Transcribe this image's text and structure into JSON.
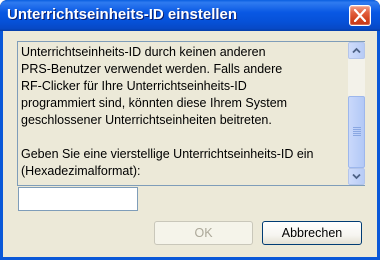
{
  "window": {
    "title": "Unterrichtseinheits-ID einstellen"
  },
  "message": {
    "lines": [
      "Unterrichtseinheits-ID durch keinen anderen",
      "PRS-Benutzer verwendet werden. Falls andere",
      "RF-Clicker für Ihre Unterrichtseinheits-ID",
      "programmiert sind, könnten diese Ihrem System",
      "geschlossener Unterrichtseinheiten beitreten.",
      "",
      "Geben Sie eine vierstellige Unterrichtseinheits-ID ein",
      "(Hexadezimalformat):"
    ]
  },
  "input": {
    "value": "",
    "placeholder": ""
  },
  "buttons": {
    "ok_label": "OK",
    "ok_enabled": false,
    "cancel_label": "Abbrechen"
  },
  "colors": {
    "titlebar": "#0054e3",
    "close_button": "#d2431e",
    "dialog_face": "#ece9d8",
    "disabled_text": "#aca899"
  }
}
